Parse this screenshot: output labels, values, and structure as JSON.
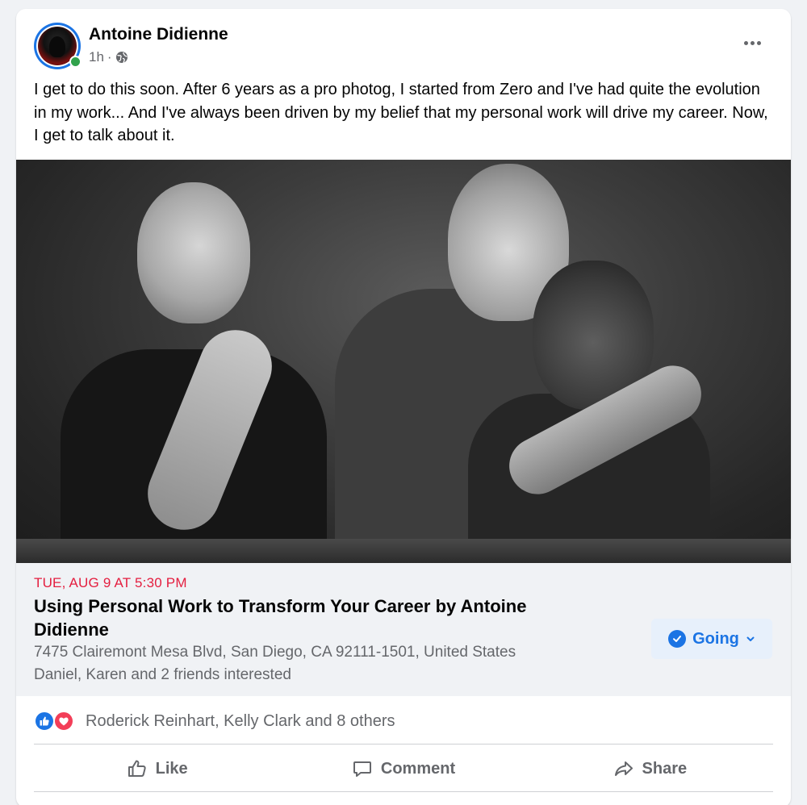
{
  "post": {
    "author": "Antoine Didienne",
    "time": "1h",
    "separator": "·",
    "audience_icon": "globe-icon",
    "more_icon": "more-options-icon",
    "text": "I get to do this soon. After 6 years as a pro photog, I started from Zero and I've had quite the evolution in my work... And I've always been driven by my belief that my personal work will drive my career. Now, I get to talk about it."
  },
  "event": {
    "date": "TUE, AUG 9 AT 5:30 PM",
    "title": "Using Personal Work to Transform Your Career by Antoine Didienne",
    "address": "7475 Clairemont Mesa Blvd, San Diego, CA 92111-1501, United States",
    "interested": "Daniel, Karen and 2 friends interested",
    "rsvp_label": "Going",
    "rsvp_icon": "check-circle-icon"
  },
  "reactions": {
    "icons": [
      "like-icon",
      "love-icon"
    ],
    "names": "Roderick Reinhart, Kelly Clark and 8 others"
  },
  "actions": {
    "like": "Like",
    "comment": "Comment",
    "share": "Share"
  },
  "colors": {
    "brand_blue": "#1b74e4",
    "date_red": "#e41e3f",
    "online_green": "#31a24c",
    "love_red": "#f33e58",
    "secondary_text": "#65676b"
  }
}
